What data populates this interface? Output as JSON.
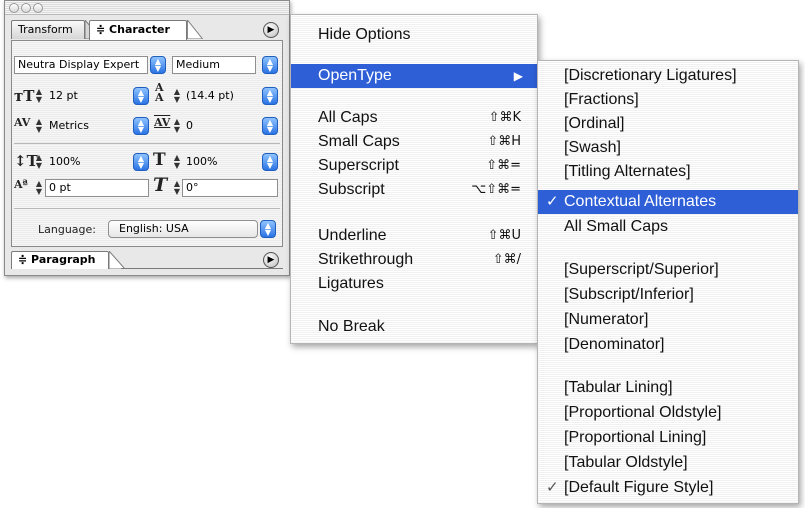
{
  "palette": {
    "tabs": [
      "Transform",
      "Character"
    ],
    "font_family": "Neutra Display Expert",
    "font_style": "Medium",
    "font_size": "12 pt",
    "leading": "(14.4 pt)",
    "kerning": "Metrics",
    "tracking": "0",
    "vertical_scale": "100%",
    "horizontal_scale": "100%",
    "baseline_shift": "0 pt",
    "skew": "0°",
    "language_label": "Language:",
    "language_value": "English: USA",
    "paragraph_tab": "Paragraph"
  },
  "menu": {
    "items": [
      {
        "label": "Hide Options"
      },
      {
        "label": "OpenType",
        "submenu": true,
        "highlighted": true
      },
      {
        "label": "All Caps",
        "shortcut": "⇧⌘K"
      },
      {
        "label": "Small Caps",
        "shortcut": "⇧⌘H"
      },
      {
        "label": "Superscript",
        "shortcut": "⇧⌘="
      },
      {
        "label": "Subscript",
        "shortcut": "⌥⇧⌘="
      },
      {
        "label": "Underline",
        "shortcut": "⇧⌘U"
      },
      {
        "label": "Strikethrough",
        "shortcut": "⇧⌘/"
      },
      {
        "label": "Ligatures"
      },
      {
        "label": "No Break"
      }
    ]
  },
  "submenu": {
    "items": [
      {
        "label": "[Discretionary Ligatures]"
      },
      {
        "label": "[Fractions]"
      },
      {
        "label": "[Ordinal]"
      },
      {
        "label": "[Swash]"
      },
      {
        "label": "[Titling Alternates]"
      },
      {
        "label": "Contextual Alternates",
        "checked": true,
        "highlighted": true
      },
      {
        "label": "All Small Caps"
      },
      {
        "label": "[Superscript/Superior]"
      },
      {
        "label": "[Subscript/Inferior]"
      },
      {
        "label": "[Numerator]"
      },
      {
        "label": "[Denominator]"
      },
      {
        "label": "[Tabular Lining]"
      },
      {
        "label": "[Proportional Oldstyle]"
      },
      {
        "label": "[Proportional Lining]"
      },
      {
        "label": "[Tabular Oldstyle]"
      },
      {
        "label": "[Default Figure Style]",
        "checked": true
      }
    ]
  },
  "colors": {
    "highlight": "#2f5fd6",
    "accent_button": "#2b74e4"
  }
}
